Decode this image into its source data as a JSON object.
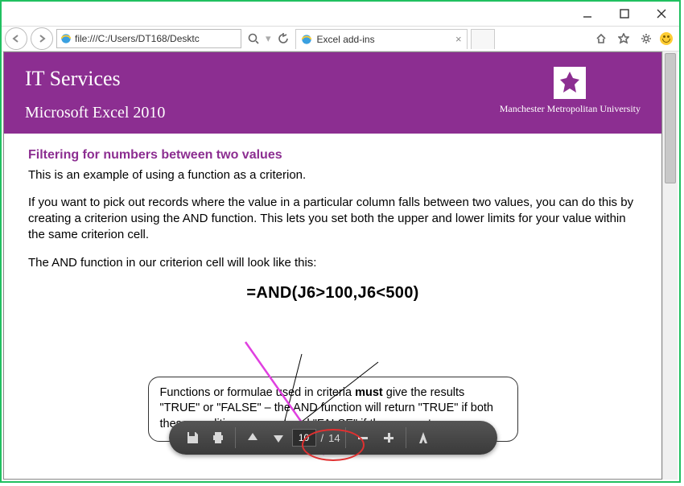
{
  "browser": {
    "address": "file:///C:/Users/DT168/Desktc",
    "tab_title": "Excel add-ins"
  },
  "header": {
    "title": "IT Services",
    "subtitle": "Microsoft Excel 2010",
    "logo_name": "Manchester Metropolitan University"
  },
  "doc": {
    "section": "Filtering for numbers between two values",
    "p1": "This is an example of using a function as a criterion.",
    "p2": "If you want to pick out records where the value in a particular column falls between two values, you can do this by creating a criterion using the AND function.  This lets you set both the upper and lower limits for your value within the same criterion cell.",
    "p3": "The AND function in our criterion cell will look like this:",
    "formula": "=AND(J6>100,J6<500)",
    "note_pre": "Functions or formulae used in criteria ",
    "note_bold": "must",
    "note_post": " give the results \"TRUE\" or \"FALSE\" – the AND function will return \"TRUE\" if both these conditions are met and \"FALSE\" if they are not"
  },
  "pdfbar": {
    "page_current": "10",
    "page_sep": "/",
    "page_total": "14"
  }
}
